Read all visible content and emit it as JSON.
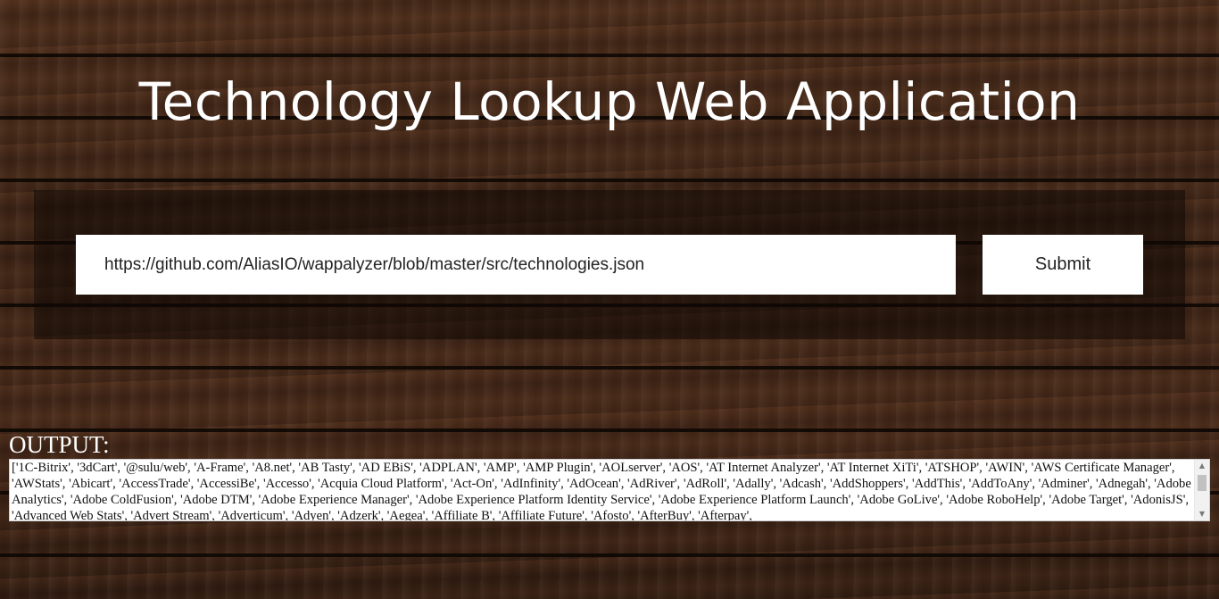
{
  "page": {
    "title": "Technology Lookup Web Application"
  },
  "form": {
    "url_value": "https://github.com/AliasIO/wappalyzer/blob/master/src/technologies.json",
    "submit_label": "Submit"
  },
  "output": {
    "label": "OUTPUT:",
    "text": "['1C-Bitrix', '3dCart', '@sulu/web', 'A-Frame', 'A8.net', 'AB Tasty', 'AD EBiS', 'ADPLAN', 'AMP', 'AMP Plugin', 'AOLserver', 'AOS', 'AT Internet Analyzer', 'AT Internet XiTi', 'ATSHOP', 'AWIN', 'AWS Certificate Manager', 'AWStats', 'Abicart', 'AccessTrade', 'AccessiBe', 'Accesso', 'Acquia Cloud Platform', 'Act-On', 'AdInfinity', 'AdOcean', 'AdRiver', 'AdRoll', 'Adally', 'Adcash', 'AddShoppers', 'AddThis', 'AddToAny', 'Adminer', 'Adnegah', 'Adobe Analytics', 'Adobe ColdFusion', 'Adobe DTM', 'Adobe Experience Manager', 'Adobe Experience Platform Identity Service', 'Adobe Experience Platform Launch', 'Adobe GoLive', 'Adobe RoboHelp', 'Adobe Target', 'AdonisJS', 'Advanced Web Stats', 'Advert Stream', 'Adverticum', 'Adyen', 'Adzerk', 'Aegea', 'Affiliate B', 'Affiliate Future', 'Afosto', 'AfterBuy', 'Afterpay',"
  },
  "colors": {
    "text_light": "#ffffff",
    "field_background": "#ffffff",
    "panel_overlay": "#0f0804"
  }
}
